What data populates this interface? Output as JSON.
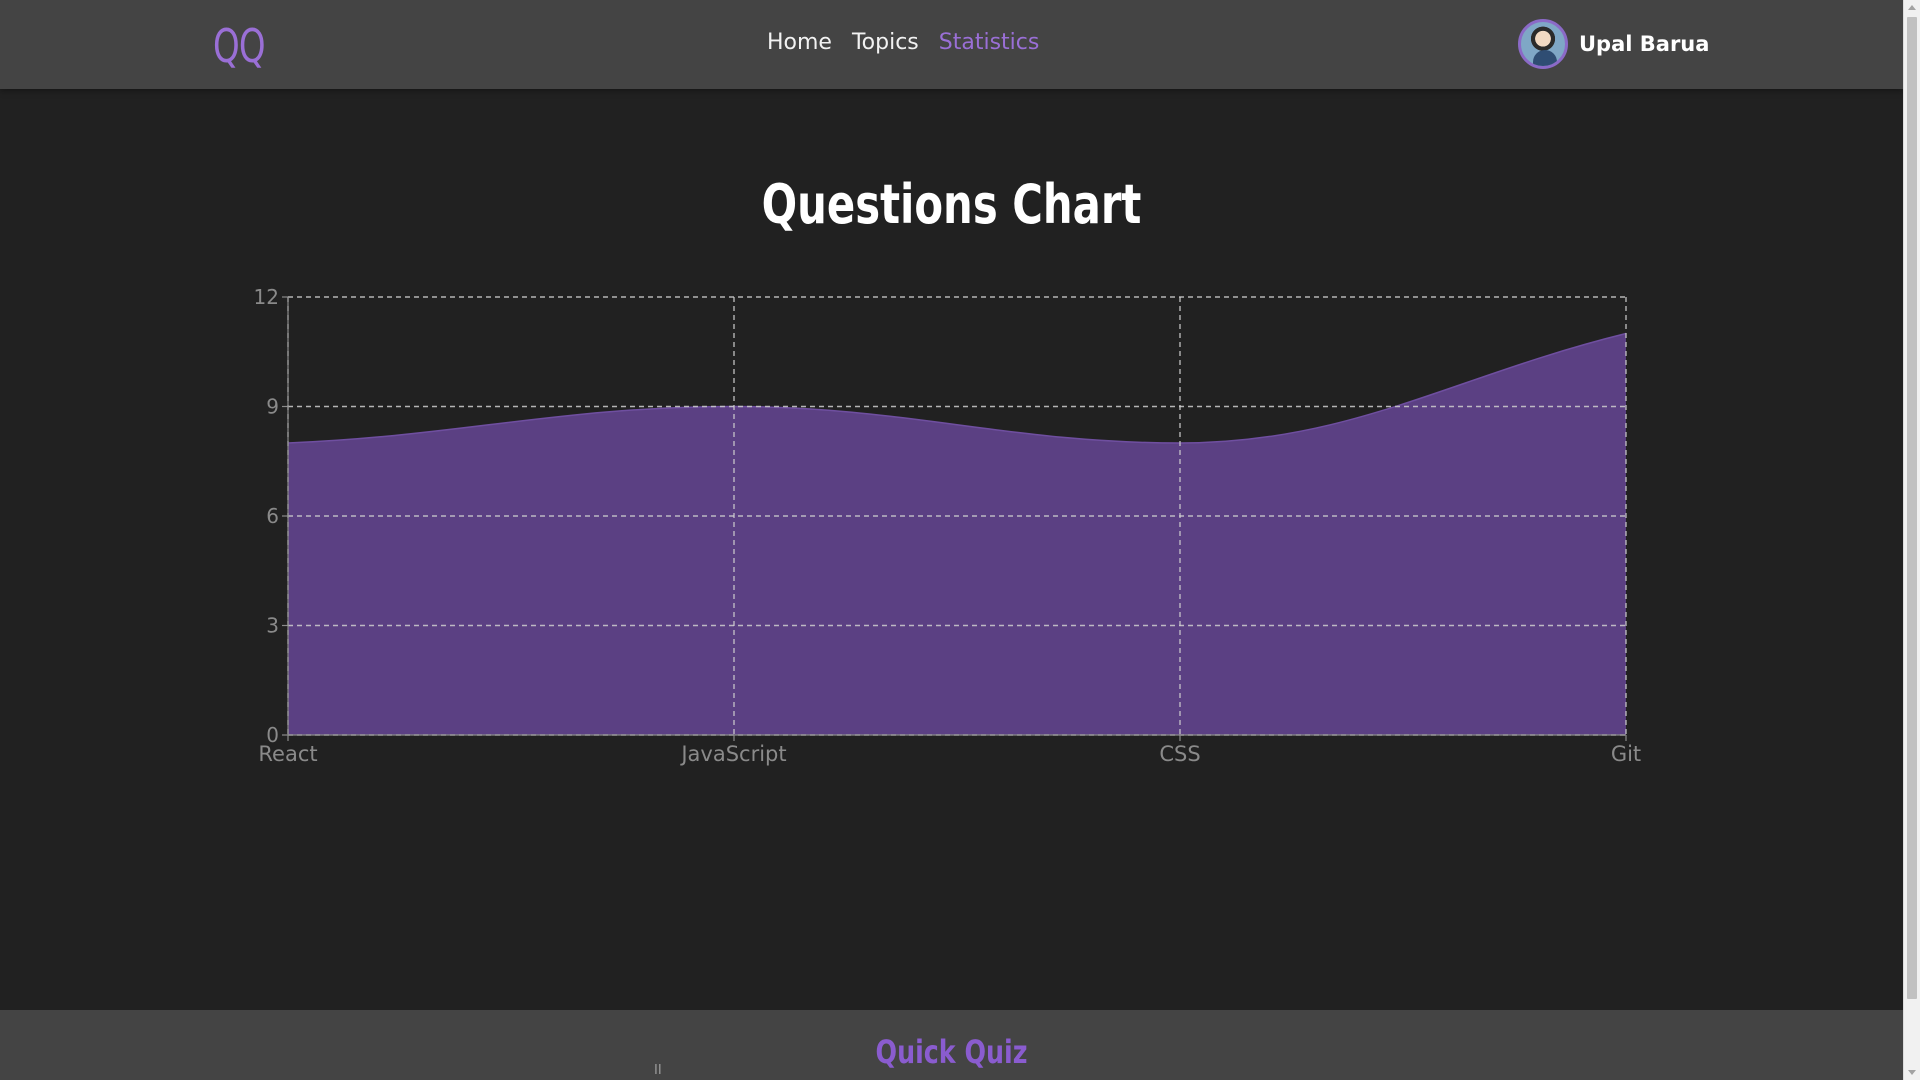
{
  "header": {
    "logo": "QQ",
    "nav": [
      {
        "label": "Home",
        "active": false
      },
      {
        "label": "Topics",
        "active": false
      },
      {
        "label": "Statistics",
        "active": true
      }
    ],
    "user": {
      "name": "Upal Barua",
      "avatar_icon": "user-avatar"
    }
  },
  "main": {
    "title": "Questions Chart"
  },
  "chart_data": {
    "type": "area",
    "categories": [
      "React",
      "JavaScript",
      "CSS",
      "Git"
    ],
    "values": [
      8,
      9,
      8,
      11
    ],
    "ylim": [
      0,
      12
    ],
    "yticks": [
      0,
      3,
      6,
      9,
      12
    ],
    "grid": true,
    "fill_color": "#5b4083",
    "stroke_color": "#6f4fa0",
    "grid_color": "#cfcfcf"
  },
  "footer": {
    "title": "Quick Quiz",
    "mark": "II"
  },
  "colors": {
    "accent": "#9a6fd6",
    "background": "#212121",
    "header": "#444444"
  }
}
